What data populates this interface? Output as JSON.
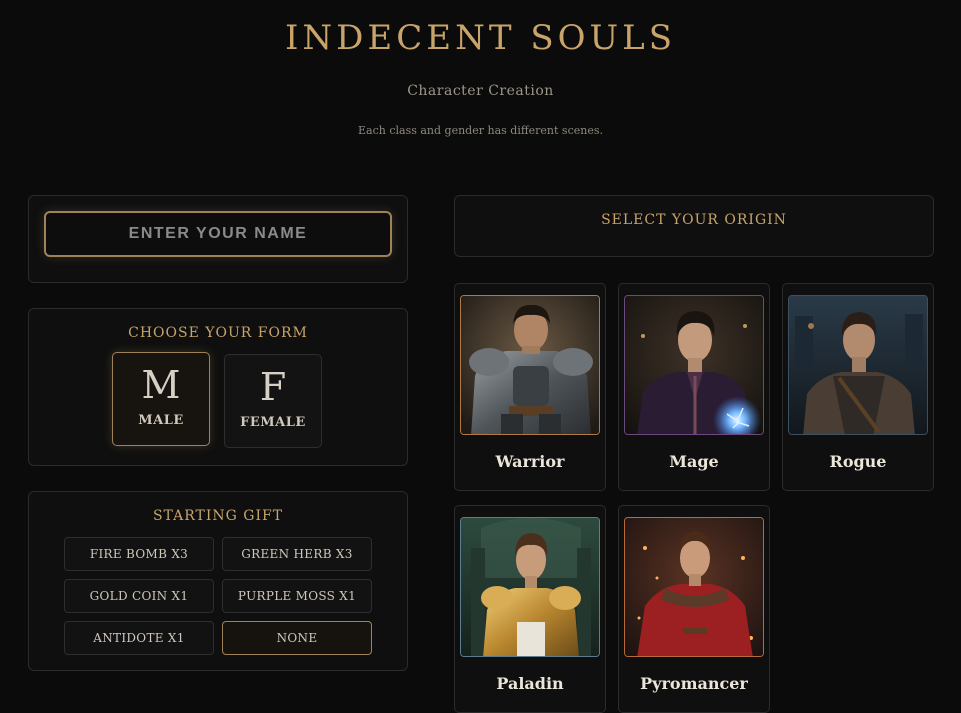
{
  "header": {
    "title": "INDECENT SOULS",
    "subtitle": "Character Creation",
    "note": "Each class and gender has different scenes."
  },
  "name_input": {
    "placeholder": "ENTER YOUR NAME",
    "value": ""
  },
  "form": {
    "heading": "CHOOSE YOUR FORM",
    "options": [
      {
        "letter": "M",
        "label": "MALE",
        "selected": true
      },
      {
        "letter": "F",
        "label": "FEMALE",
        "selected": false
      }
    ]
  },
  "gift": {
    "heading": "STARTING GIFT",
    "options": [
      {
        "label": "FIRE BOMB X3",
        "selected": false
      },
      {
        "label": "GREEN HERB X3",
        "selected": false
      },
      {
        "label": "GOLD COIN X1",
        "selected": false
      },
      {
        "label": "PURPLE MOSS X1",
        "selected": false
      },
      {
        "label": "ANTIDOTE X1",
        "selected": false
      },
      {
        "label": "NONE",
        "selected": true
      }
    ]
  },
  "origin": {
    "heading": "SELECT YOUR ORIGIN",
    "classes": [
      {
        "name": "Warrior",
        "portrait": "warrior-portrait",
        "accent": "#b07a45"
      },
      {
        "name": "Mage",
        "portrait": "mage-portrait",
        "accent": "#6b4a80"
      },
      {
        "name": "Rogue",
        "portrait": "rogue-portrait",
        "accent": "#3c5060"
      },
      {
        "name": "Paladin",
        "portrait": "paladin-portrait",
        "accent": "#5c7f90"
      },
      {
        "name": "Pyromancer",
        "portrait": "pyromancer-portrait",
        "accent": "#b86a3a"
      }
    ]
  }
}
